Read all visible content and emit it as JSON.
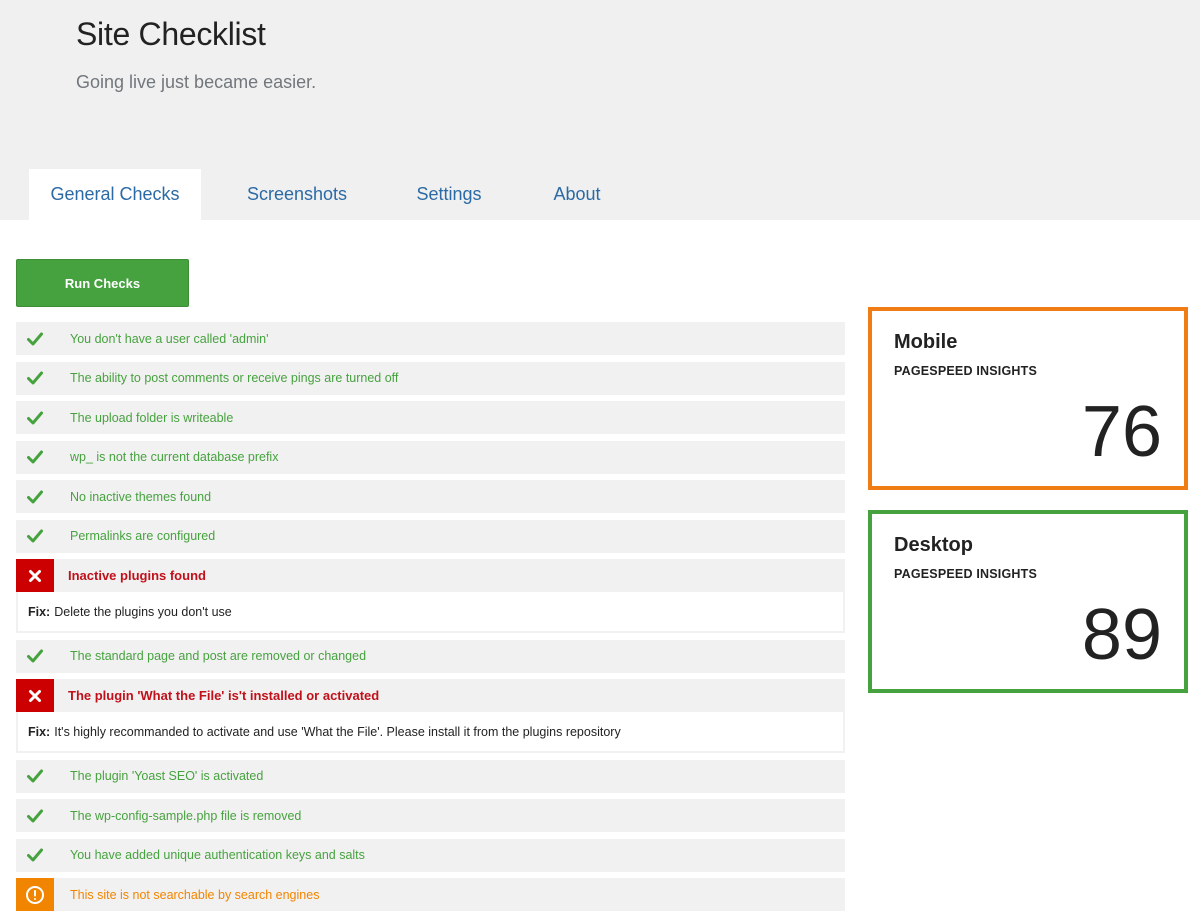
{
  "header": {
    "title": "Site Checklist",
    "tagline": "Going live just became easier."
  },
  "tabs": [
    {
      "label": "General Checks",
      "active": true
    },
    {
      "label": "Screenshots",
      "active": false
    },
    {
      "label": "Settings",
      "active": false
    },
    {
      "label": "About",
      "active": false
    }
  ],
  "run_button": "Run Checks",
  "checks": [
    {
      "status": "ok",
      "label": "You don't have a user called 'admin'"
    },
    {
      "status": "ok",
      "label": "The ability to post comments or receive pings are turned off"
    },
    {
      "status": "ok",
      "label": "The upload folder is writeable"
    },
    {
      "status": "ok",
      "label": "wp_ is not the current database prefix"
    },
    {
      "status": "ok",
      "label": "No inactive themes found"
    },
    {
      "status": "ok",
      "label": "Permalinks are configured"
    },
    {
      "status": "fail",
      "label": "Inactive plugins found",
      "fix_label": "Fix:",
      "fix": "Delete the plugins you don't use"
    },
    {
      "status": "ok",
      "label": "The standard page and post are removed or changed"
    },
    {
      "status": "fail",
      "label": "The plugin 'What the File' is't installed or activated",
      "fix_label": "Fix:",
      "fix": "It's highly recommanded to activate and use 'What the File'. Please install it from the plugins repository"
    },
    {
      "status": "ok",
      "label": "The plugin 'Yoast SEO' is activated"
    },
    {
      "status": "ok",
      "label": "The wp-config-sample.php file is removed"
    },
    {
      "status": "ok",
      "label": "You have added unique authentication keys and salts"
    },
    {
      "status": "warn",
      "label": "This site is not searchable by search engines"
    }
  ],
  "scores": {
    "mobile": {
      "title": "Mobile",
      "subtitle": "PAGESPEED INSIGHTS",
      "value": "76",
      "color": "#f07c16"
    },
    "desktop": {
      "title": "Desktop",
      "subtitle": "PAGESPEED INSIGHTS",
      "value": "89",
      "color": "#46a23f"
    }
  },
  "colors": {
    "ok": "#46a23f",
    "fail": "#cc0000",
    "warn": "#f18500",
    "link": "#2b6aa5"
  },
  "icons": {
    "ok": "checkmark-icon",
    "fail": "x-icon",
    "warn": "exclamation-icon"
  }
}
